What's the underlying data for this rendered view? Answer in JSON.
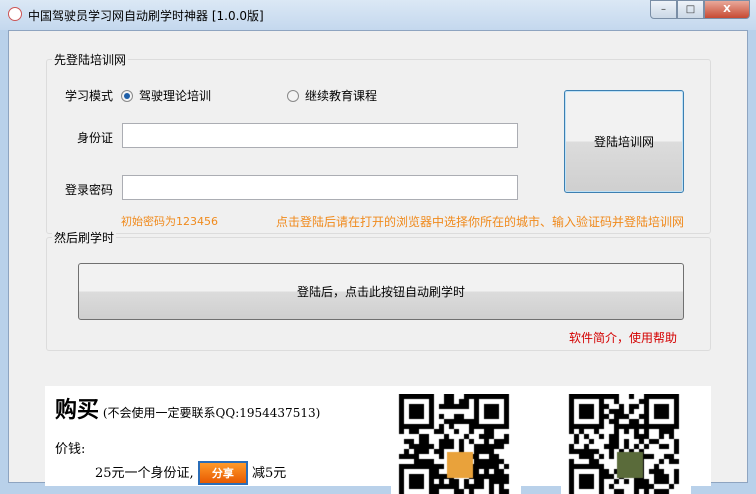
{
  "window": {
    "title": "中国驾驶员学习网自动刷学时神器 [1.0.0版]",
    "min": "–",
    "max": "□",
    "close": "X"
  },
  "login_group": {
    "label": "先登陆培训网",
    "mode_label": "学习模式",
    "mode_options": [
      "驾驶理论培训",
      "继续教育课程"
    ],
    "selected_mode": "驾驶理论培训",
    "id_label": "身份证",
    "id_value": "",
    "password_label": "登录密码",
    "password_value": "",
    "login_button": "登陆培训网",
    "hint_password": "初始密码为123456",
    "hint_login": "点击登陆后请在打开的浏览器中选择你所在的城市、输入验证码并登陆培训网"
  },
  "study_group": {
    "label": "然后刷学时",
    "start_button": "登陆后，点击此按钮自动刷学时",
    "help_link": "软件简介，使用帮助"
  },
  "buy": {
    "title": "购买",
    "contact": "(不会使用一定要联系QQ:1954437513)",
    "price_label": "价钱:",
    "price_text": "25元一个身份证,",
    "share_button": "分享",
    "discount": "减5元"
  },
  "colors": {
    "hint": "#f08a1c",
    "link": "#d40000",
    "share": "#f07000"
  }
}
